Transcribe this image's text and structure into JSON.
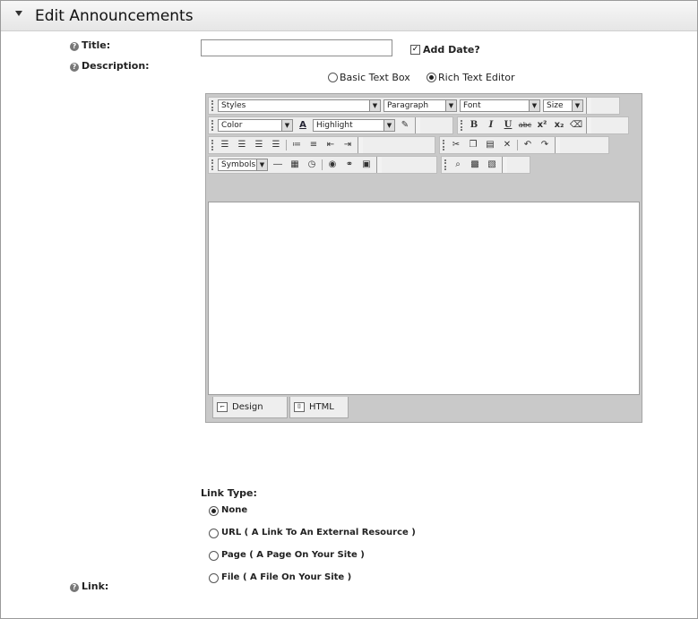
{
  "header": {
    "title": "Edit Announcements"
  },
  "help_glyph": "?",
  "fields": {
    "title_label": "Title:",
    "add_date_label": "Add Date?",
    "add_date_checked": true,
    "description_label": "Description:",
    "basic_text_box": "Basic Text Box",
    "rich_text_editor": "Rich Text Editor",
    "editor_mode_selected": "Rich Text Editor"
  },
  "editor": {
    "styles": "Styles",
    "paragraph": "Paragraph",
    "font": "Font",
    "size": "Size",
    "color": "Color",
    "highlight": "Highlight",
    "symbols": "Symbols",
    "buttons": {
      "bold": "B",
      "italic": "I",
      "underline": "U",
      "strike": "abc",
      "superscript": "x²",
      "subscript": "x₂",
      "text_color_glyph": "A"
    },
    "tabs": {
      "design": "Design",
      "html": "HTML"
    },
    "active_tab": "Design"
  },
  "link": {
    "link_type_label": "Link Type:",
    "options": [
      "None",
      "URL ( A Link To An External Resource )",
      "Page ( A Page On Your Site )",
      "File ( A File On Your Site )"
    ],
    "selected": "None",
    "link_label": "Link:"
  }
}
